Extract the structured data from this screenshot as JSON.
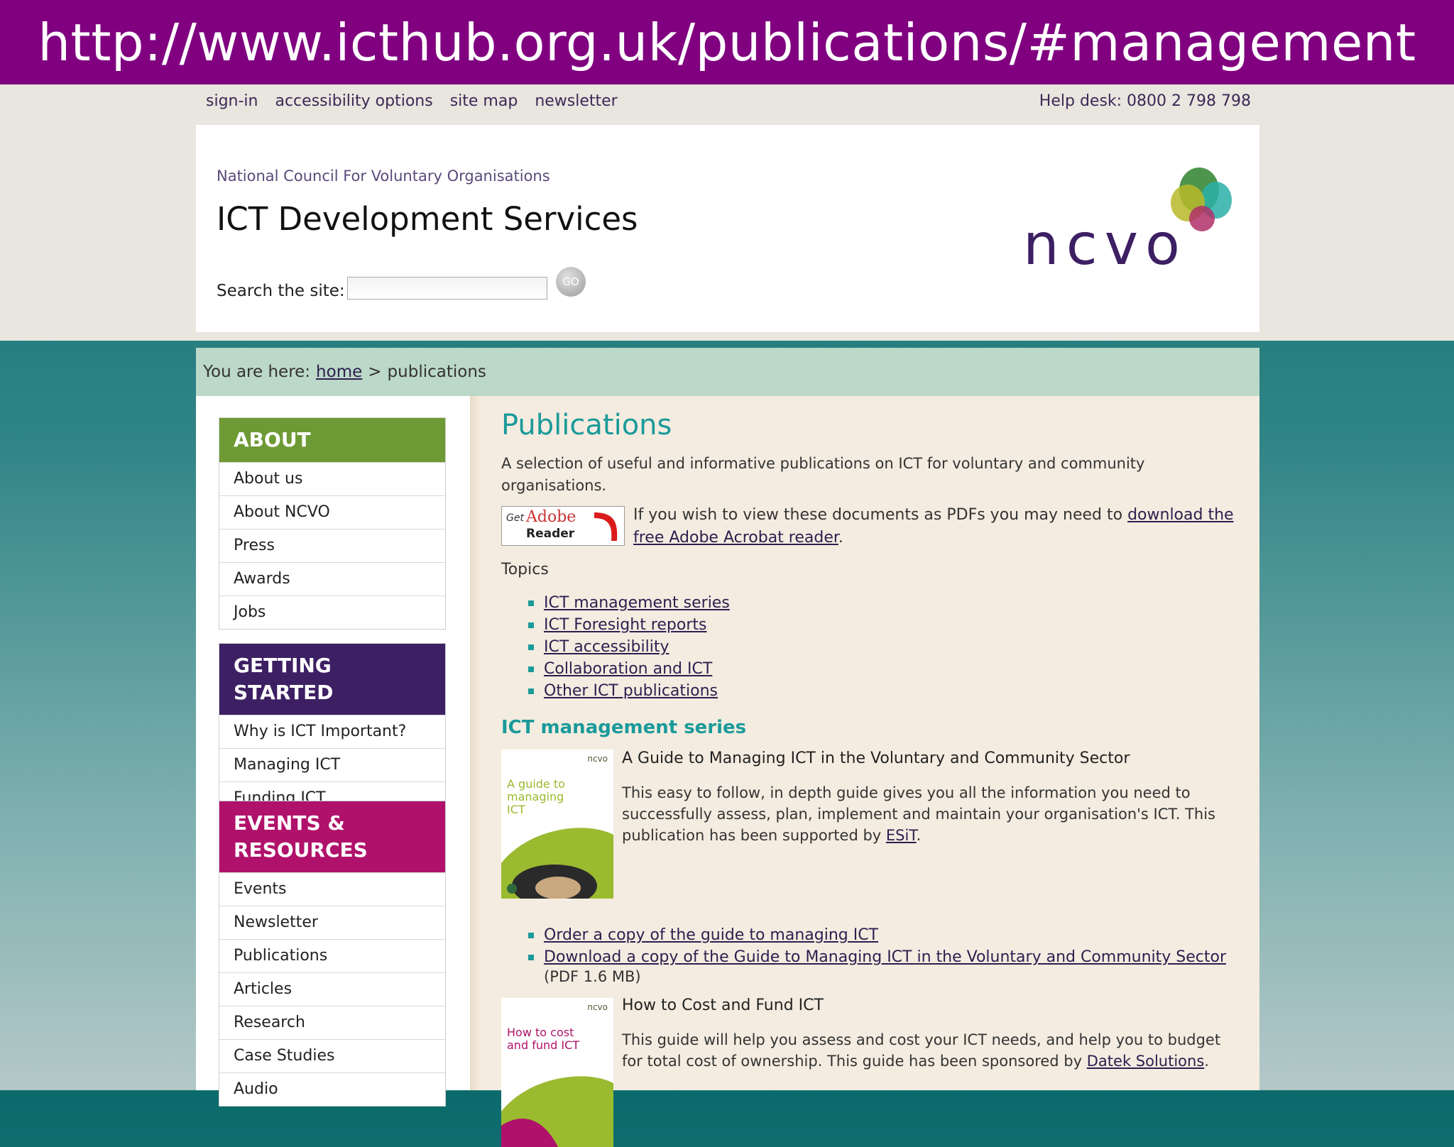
{
  "banner": {
    "url": "http://www.icthub.org.uk/publications/#management"
  },
  "utility": {
    "links": [
      "sign-in",
      "accessibility options",
      "site map",
      "newsletter"
    ],
    "helpdesk": "Help desk: 0800 2 798 798"
  },
  "header": {
    "org": "National Council For Voluntary Organisations",
    "title": "ICT Development Services",
    "search_label": "Search the site:",
    "search_placeholder": "",
    "go_label": "GO",
    "logo_text": "ncvo"
  },
  "breadcrumb": {
    "prefix": "You are here:",
    "home": "home",
    "sep": ">",
    "current": "publications"
  },
  "sidebar": {
    "about": {
      "heading": "ABOUT",
      "items": [
        "About us",
        "About NCVO",
        "Press",
        "Awards",
        "Jobs"
      ]
    },
    "getting_started": {
      "heading": "GETTING STARTED",
      "items": [
        "Why is ICT Important?",
        "Managing ICT",
        "Funding ICT"
      ]
    },
    "events": {
      "heading_1": "EVENTS &",
      "heading_2": "RESOURCES",
      "items": [
        "Events",
        "Newsletter",
        "Publications",
        "Articles",
        "Research",
        "Case Studies",
        "Audio"
      ]
    }
  },
  "content": {
    "title": "Publications",
    "intro": "A selection of useful and informative publications on ICT for voluntary and community organisations.",
    "adobe": {
      "badge_get": "Get",
      "badge_adobe": "Adobe",
      "badge_reader": "Reader",
      "text_before": "If you wish to view these documents as PDFs you may need to ",
      "link": "download the free Adobe Acrobat reader",
      "text_after": "."
    },
    "topics_label": "Topics",
    "topics": [
      "ICT management series",
      "ICT Foresight reports",
      "ICT accessibility",
      "Collaboration and ICT",
      "Other ICT publications"
    ],
    "mgmt_heading": "ICT management series",
    "pub1": {
      "cover_title": "A guide to managing ICT",
      "cover_brand": "ncvo",
      "heading": "A Guide to Managing ICT in the Voluntary and Community Sector",
      "desc_before": "This easy to follow, in depth guide gives you all the information you need to successfully assess, plan, implement and maintain your organisation's ICT. This publication has been supported by ",
      "desc_link": "ESiT",
      "desc_after": ".",
      "links": [
        "Order a copy of the guide to managing ICT",
        "Download a copy of the Guide to Managing ICT in the Voluntary and Community Sector"
      ],
      "pdf_note": "(PDF 1.6 MB)"
    },
    "pub2": {
      "cover_title": "How to cost and fund ICT",
      "cover_brand": "ncvo",
      "heading": "How to Cost and Fund ICT",
      "desc_before": "This guide will help you assess and cost your ICT needs, and help you to budget for total cost of ownership.  This guide has been sponsored by ",
      "desc_link": "Datek Solutions",
      "desc_after": "."
    }
  },
  "colors": {
    "banner": "#800080",
    "teal": "#1a9a9a",
    "about_green": "#6e9a35",
    "getting_started_purple": "#3d1f63",
    "events_magenta": "#b0116a"
  }
}
